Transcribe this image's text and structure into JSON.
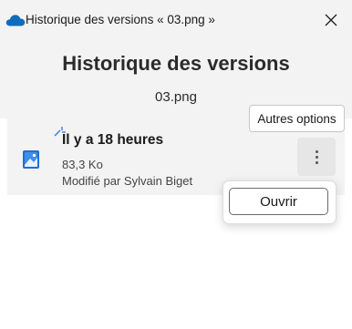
{
  "window": {
    "title": "Historique des versions « 03.png »",
    "close_icon": "close-icon",
    "app_icon": "onedrive-cloud-icon",
    "brand_color": "#0f6cbd"
  },
  "header": {
    "title": "Historique des versions",
    "filename": "03.png"
  },
  "version": {
    "time": "Il y a 18 heures",
    "size": "83,3 Ko",
    "modified_by": "Modifié par Sylvain Biget",
    "file_icon": "image-file-icon",
    "more_icon": "more-vertical-icon"
  },
  "tooltip": {
    "text": "Autres options"
  },
  "menu": {
    "open_label": "Ouvrir"
  }
}
